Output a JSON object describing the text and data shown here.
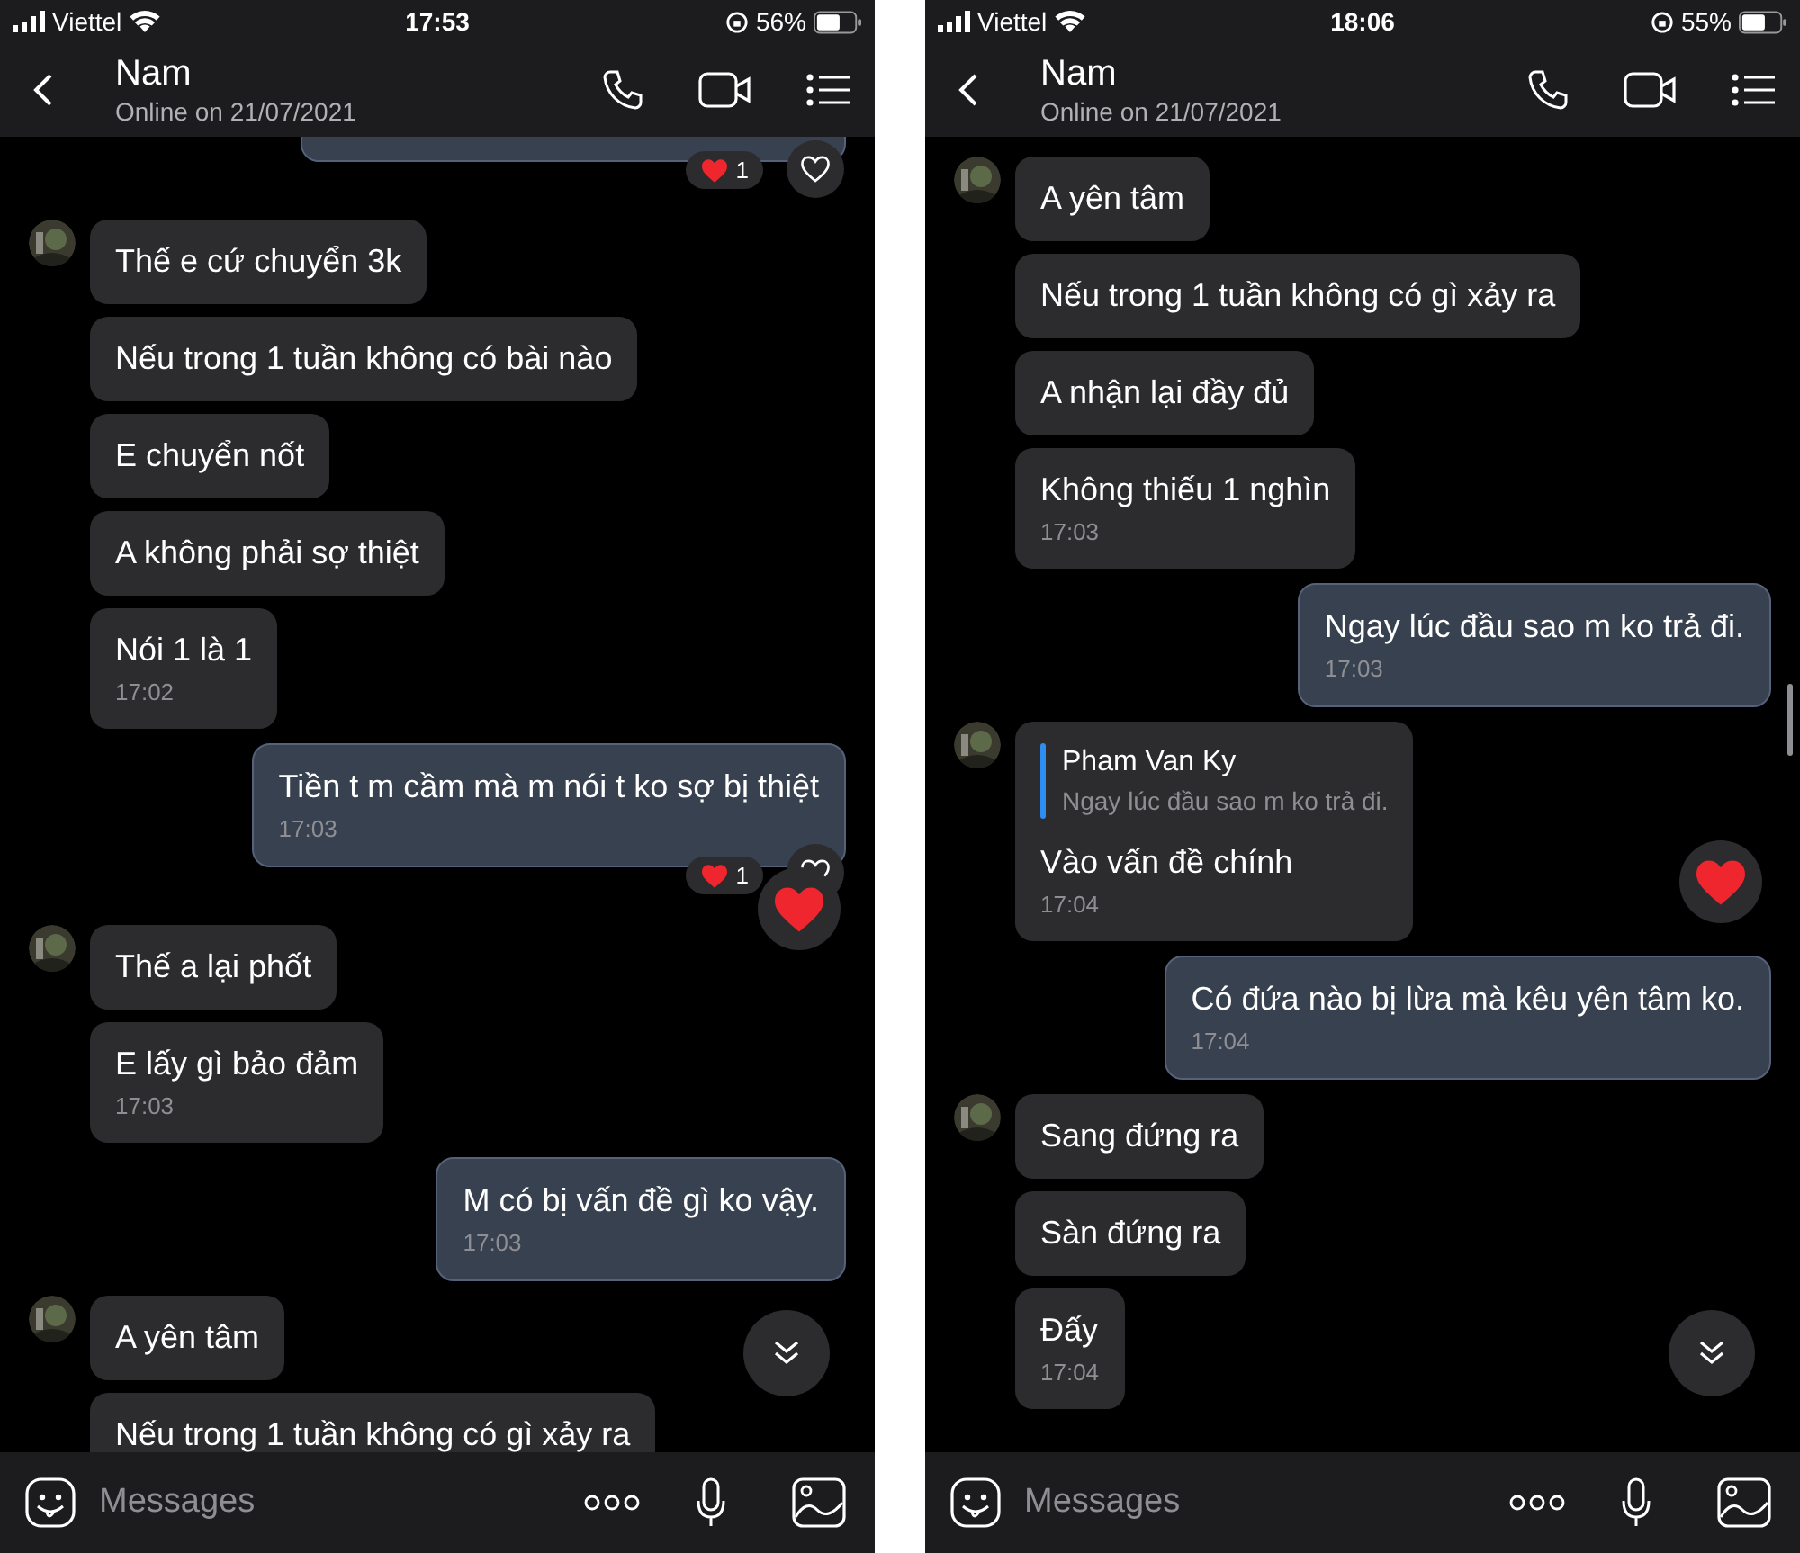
{
  "screens": [
    {
      "status": {
        "carrier": "Viettel",
        "time": "17:53",
        "battery": "56%"
      },
      "header": {
        "name": "Nam",
        "status": "Online on 21/07/2021"
      },
      "cut_top": {
        "reaction_count": "1"
      },
      "groups": [
        {
          "kind": "in",
          "messages": [
            {
              "text": "Thế e cứ chuyển 3k"
            },
            {
              "text": "Nếu trong 1 tuần không có bài nào"
            },
            {
              "text": "E chuyển nốt"
            },
            {
              "text": "A không phải sợ thiệt"
            },
            {
              "text": "Nói 1 là 1",
              "time": "17:02"
            }
          ]
        },
        {
          "kind": "out",
          "messages": [
            {
              "text": "Tiền t m cầm mà m nói t ko sợ bị thiệt",
              "time": "17:03",
              "reaction_count": "1",
              "big_heart": true
            }
          ]
        },
        {
          "kind": "in",
          "messages": [
            {
              "text": "Thế a lại phốt"
            },
            {
              "text": "E lấy gì bảo đảm",
              "time": "17:03"
            }
          ]
        },
        {
          "kind": "out",
          "messages": [
            {
              "text": "M có bị vấn đề gì ko vậy.",
              "time": "17:03"
            }
          ]
        },
        {
          "kind": "in",
          "messages": [
            {
              "text": "A yên tâm"
            },
            {
              "text": "Nếu trong 1 tuần không có gì xảy ra"
            }
          ]
        }
      ],
      "input": {
        "placeholder": "Messages"
      }
    },
    {
      "status": {
        "carrier": "Viettel",
        "time": "18:06",
        "battery": "55%"
      },
      "header": {
        "name": "Nam",
        "status": "Online on 21/07/2021"
      },
      "groups": [
        {
          "kind": "in",
          "messages": [
            {
              "text": "A yên tâm"
            },
            {
              "text": "Nếu trong 1 tuần không có gì xảy ra"
            },
            {
              "text": "A nhận lại đầy đủ"
            },
            {
              "text": "Không thiếu 1 nghìn",
              "time": "17:03"
            }
          ]
        },
        {
          "kind": "out",
          "messages": [
            {
              "text": "Ngay lúc đầu sao m ko trả đi.",
              "time": "17:03"
            }
          ]
        },
        {
          "kind": "in",
          "messages": [
            {
              "quote": {
                "author": "Pham Van Ky",
                "text": "Ngay lúc đầu sao m ko trả đi."
              },
              "text": "Vào vấn đề chính",
              "time": "17:04",
              "big_heart": true
            }
          ]
        },
        {
          "kind": "out",
          "messages": [
            {
              "text": "Có đứa nào bị lừa mà kêu yên tâm ko.",
              "time": "17:04"
            }
          ]
        },
        {
          "kind": "in",
          "messages": [
            {
              "text": "Sang đứng ra"
            },
            {
              "text": "Sàn đứng ra"
            },
            {
              "text": "Đấy",
              "time": "17:04"
            }
          ]
        }
      ],
      "input": {
        "placeholder": "Messages"
      }
    }
  ]
}
